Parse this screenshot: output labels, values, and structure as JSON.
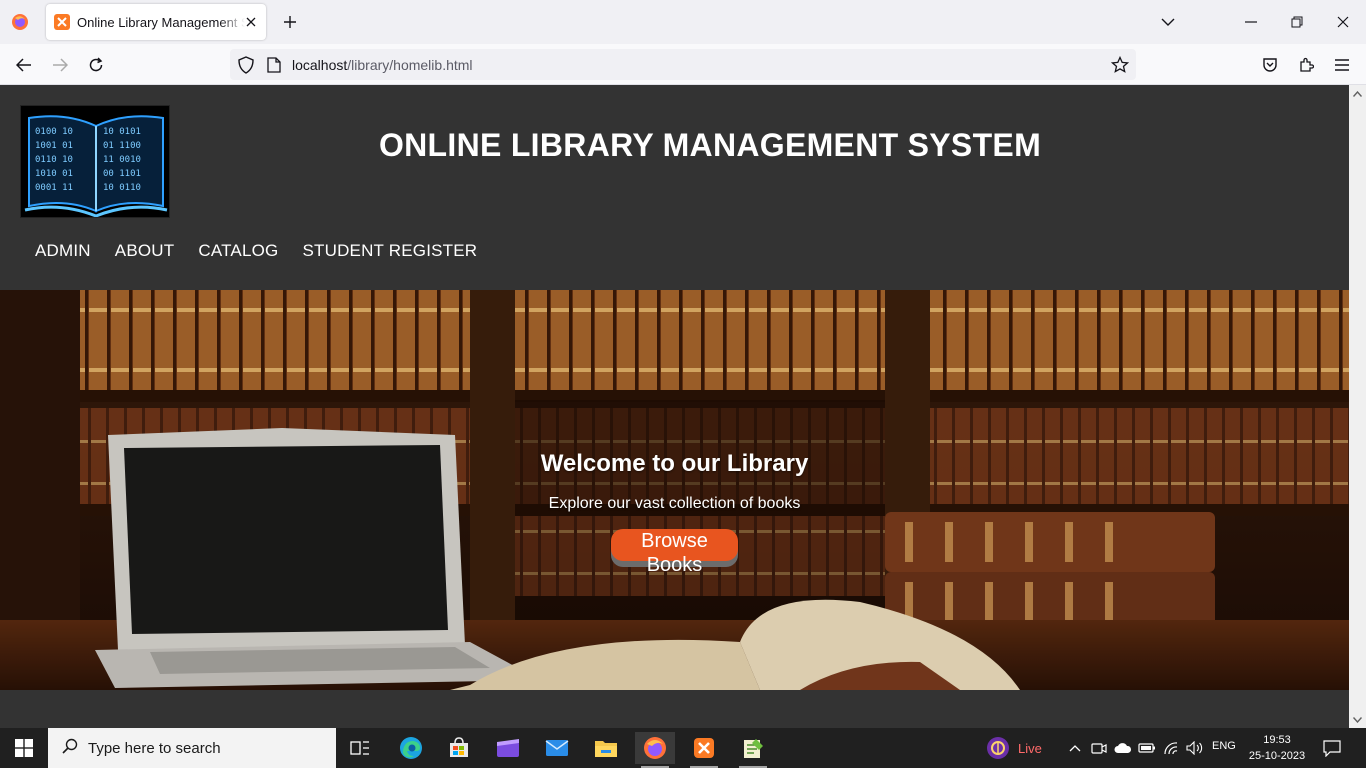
{
  "browser": {
    "tab_title": "Online Library Management System",
    "url_host": "localhost",
    "url_path": "/library/homelib.html"
  },
  "site": {
    "title": "ONLINE LIBRARY MANAGEMENT SYSTEM",
    "menu": [
      "ADMIN",
      "ABOUT",
      "CATALOG",
      "STUDENT REGISTER"
    ],
    "hero": {
      "heading": "Welcome to our Library",
      "subheading": "Explore our vast collection of books",
      "button": "Browse Books"
    }
  },
  "taskbar": {
    "search_placeholder": "Type here to search",
    "live_label": "Live",
    "language": "ENG",
    "time": "19:53",
    "date": "25-10-2023"
  },
  "colors": {
    "page_bg": "#333333",
    "button_accent": "#e8551f",
    "browser_toolbar": "#f9f9fb",
    "taskbar": "#202020"
  }
}
